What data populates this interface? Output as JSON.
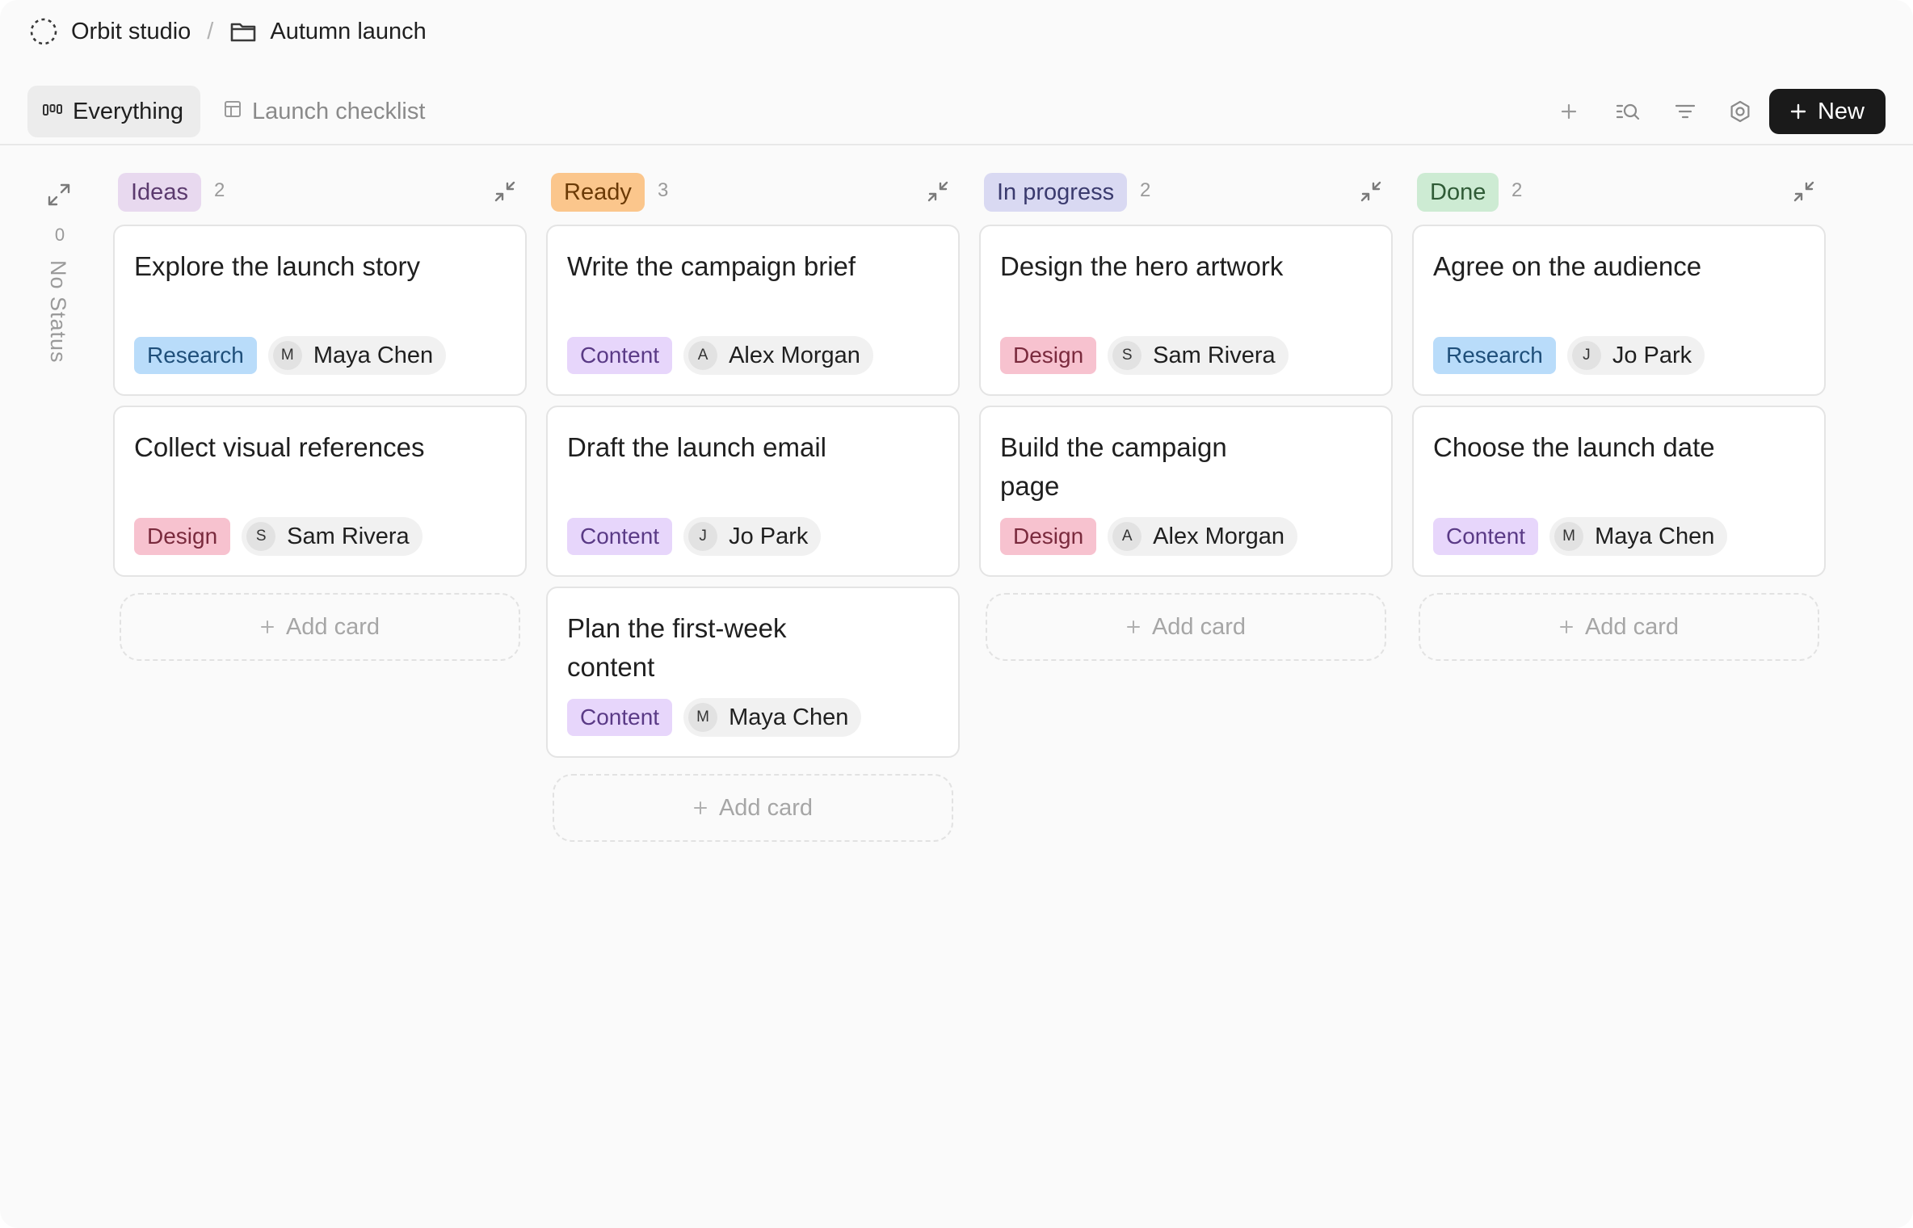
{
  "breadcrumb": {
    "workspace": "Orbit studio",
    "separator": "/",
    "project": "Autumn launch"
  },
  "views": {
    "everything": "Everything",
    "checklist": "Launch checklist"
  },
  "toolbar": {
    "new_label": "New"
  },
  "no_status": {
    "count": "0",
    "label": "No Status"
  },
  "add_card_label": "Add card",
  "columns": [
    {
      "name": "Ideas",
      "count": "2",
      "pill_bg": "#e8d9ef",
      "pill_fg": "#5b3a6e",
      "cards": [
        {
          "title": "Explore the launch story",
          "tag": "Research",
          "assignee": "Maya Chen",
          "initial": "M"
        },
        {
          "title": "Collect visual references",
          "tag": "Design",
          "assignee": "Sam Rivera",
          "initial": "S"
        }
      ]
    },
    {
      "name": "Ready",
      "count": "3",
      "pill_bg": "#fbc68c",
      "pill_fg": "#6b3a06",
      "cards": [
        {
          "title": "Write the campaign brief",
          "tag": "Content",
          "assignee": "Alex Morgan",
          "initial": "A"
        },
        {
          "title": "Draft the launch email",
          "tag": "Content",
          "assignee": "Jo Park",
          "initial": "J"
        },
        {
          "title": "Plan the first-week content",
          "tag": "Content",
          "assignee": "Maya Chen",
          "initial": "M"
        }
      ]
    },
    {
      "name": "In progress",
      "count": "2",
      "pill_bg": "#d9d9f2",
      "pill_fg": "#3a3a6e",
      "cards": [
        {
          "title": "Design the hero artwork",
          "tag": "Design",
          "assignee": "Sam Rivera",
          "initial": "S"
        },
        {
          "title": "Build the campaign page",
          "tag": "Design",
          "assignee": "Alex Morgan",
          "initial": "A"
        }
      ]
    },
    {
      "name": "Done",
      "count": "2",
      "pill_bg": "#cdebd3",
      "pill_fg": "#2f5b36",
      "cards": [
        {
          "title": "Agree on the audience",
          "tag": "Research",
          "assignee": "Jo Park",
          "initial": "J"
        },
        {
          "title": "Choose the launch date",
          "tag": "Content",
          "assignee": "Maya Chen",
          "initial": "M"
        }
      ]
    }
  ],
  "tag_colors": {
    "Research": {
      "bg": "#b9dcfa",
      "fg": "#1f4f7a"
    },
    "Design": {
      "bg": "#f7c2cf",
      "fg": "#7a2a3d"
    },
    "Content": {
      "bg": "#e7d6fb",
      "fg": "#5a3a86"
    }
  }
}
